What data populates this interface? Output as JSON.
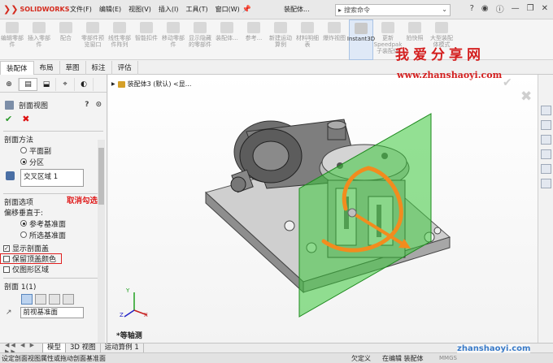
{
  "titlebar": {
    "logo": "SOLIDWORKS",
    "menus": [
      "文件(F)",
      "编辑(E)",
      "视图(V)",
      "插入(I)",
      "工具(T)",
      "窗口(W)"
    ],
    "doc_title": "装配体...",
    "search_placeholder": "搜索命令",
    "pin_icon": "pin-icon"
  },
  "ribbon": {
    "buttons": [
      {
        "label": "编辑零部件"
      },
      {
        "label": "插入零部件"
      },
      {
        "label": "配合"
      },
      {
        "label": "零部件预览窗口"
      },
      {
        "label": "线性零部件阵列"
      },
      {
        "label": "智能扣件"
      },
      {
        "label": "移动零部件"
      },
      {
        "label": "显示隐藏的零部件"
      },
      {
        "label": "装配体..."
      },
      {
        "label": "参考..."
      },
      {
        "label": "新建运动算例"
      },
      {
        "label": "材料明细表"
      },
      {
        "label": "爆炸视图"
      },
      {
        "label": "Instant3D",
        "active": true
      },
      {
        "label": "更新 Speedpak 子装配体"
      },
      {
        "label": "拍快照"
      },
      {
        "label": "大型装配体模式"
      }
    ]
  },
  "command_tabs": [
    {
      "label": "装配体",
      "selected": true
    },
    {
      "label": "布局"
    },
    {
      "label": "草图"
    },
    {
      "label": "标注"
    },
    {
      "label": "评估"
    }
  ],
  "panel": {
    "title": "剖面视图",
    "ok": "✔",
    "cancel": "✖",
    "section_method": {
      "title": "剖面方法",
      "options": [
        "平面副",
        "分区"
      ],
      "selected": "分区",
      "list_value": "交叉区域 1"
    },
    "section_options": {
      "title": "剖面选项",
      "offset_label": "偏移垂直于:",
      "options": [
        "参考基准面",
        "所选基准面"
      ],
      "selected": "参考基准面"
    },
    "checkboxes": [
      {
        "label": "显示剖面盖",
        "checked": true
      },
      {
        "label": "保留顶盖颜色",
        "checked": false,
        "highlighted": true
      },
      {
        "label": "仅图形区域",
        "checked": false
      }
    ],
    "annotation": "取消勾选",
    "section1": {
      "title": "剖面 1(1)",
      "plane": "前视基准面"
    }
  },
  "viewport": {
    "tree_label": "装配体3 (默认) <显...",
    "view_name": "*等轴测",
    "watermark_cn": "我爱分享网",
    "watermark_url": "www.zhanshaoyi.com",
    "triad": {
      "x": "X",
      "y": "Y",
      "z": "Z"
    }
  },
  "bottom_tabs": [
    "模型",
    "3D 视图",
    "运动算例 1"
  ],
  "status": {
    "hint": "设定剖面视图属性或拖动剖面基准面",
    "state1": "欠定义",
    "state2": "在编辑 装配体",
    "units": "MMGS",
    "watermark": "zhanshaoyi.com"
  },
  "colors": {
    "accent_red": "#d52b1e",
    "plane_green": "#3cc83c",
    "arrow_orange": "#f28c1e"
  }
}
